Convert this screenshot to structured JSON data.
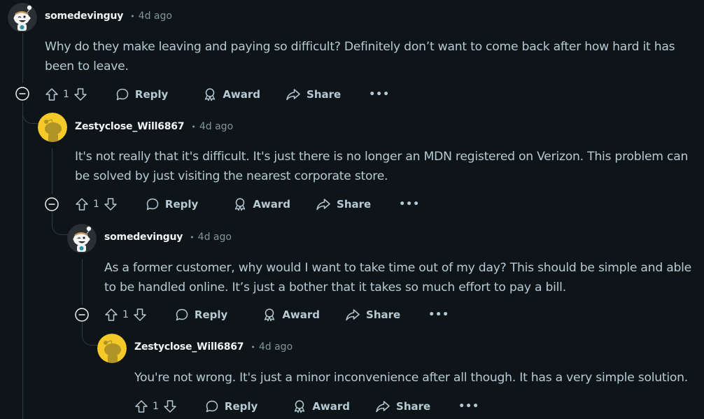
{
  "theme": {
    "background": "#0e1519",
    "text": "#b7cad4",
    "muted": "#82959b",
    "author": "#f2f4f5",
    "thread_line": "#2e3b42",
    "avatar_yellow": "#f5c928"
  },
  "comments": [
    {
      "author": "somedevinguy",
      "separator": "•",
      "time": "4d ago",
      "avatar": "snoo-avatar-custom",
      "lines": [
        "Why do they make leaving and paying so difficult? Definitely don’t want to come back after how hard it has",
        "been to leave."
      ],
      "votes": "1",
      "actions": {
        "reply": "Reply",
        "award": "Award",
        "share": "Share",
        "more": "•••"
      }
    },
    {
      "author": "Zestyclose_Will6867",
      "separator": "•",
      "time": "4d ago",
      "avatar": "snoo-avatar-default-yellow",
      "lines": [
        "It's not really that it's difficult. It's just there is no longer an MDN registered on Verizon. This problem can",
        "be solved by just visiting the nearest corporate store."
      ],
      "votes": "1",
      "actions": {
        "reply": "Reply",
        "award": "Award",
        "share": "Share",
        "more": "•••"
      }
    },
    {
      "author": "somedevinguy",
      "separator": "•",
      "time": "4d ago",
      "avatar": "snoo-avatar-custom",
      "lines": [
        "As a former customer, why would I want to take time out of my day? This should be simple and able",
        "to be handled online. It’s just a bother that it takes so much effort to pay a bill."
      ],
      "votes": "1",
      "actions": {
        "reply": "Reply",
        "award": "Award",
        "share": "Share",
        "more": "•••"
      }
    },
    {
      "author": "Zestyclose_Will6867",
      "separator": "•",
      "time": "4d ago",
      "avatar": "snoo-avatar-default-yellow",
      "lines": [
        "You're not wrong. It's just a minor inconvenience after all though. It has a very simple solution."
      ],
      "votes": "1",
      "actions": {
        "reply": "Reply",
        "award": "Award",
        "share": "Share",
        "more": "•••"
      }
    }
  ]
}
